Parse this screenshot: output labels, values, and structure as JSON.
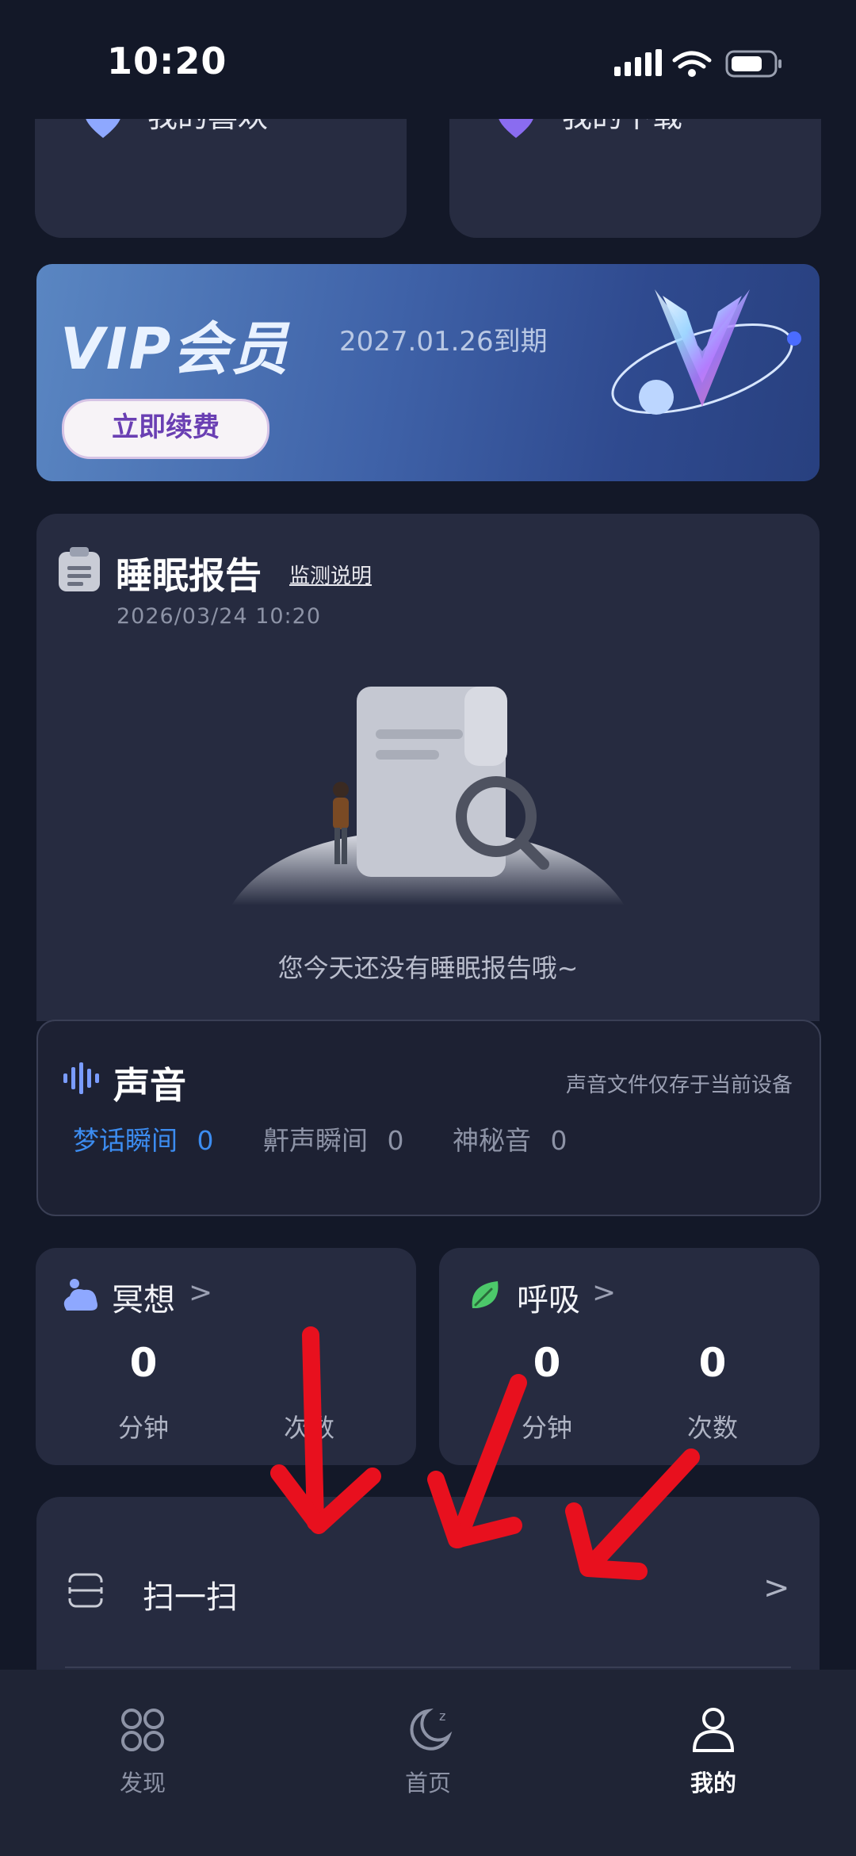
{
  "status_bar": {
    "time": "10:20",
    "battery_level": 0.7
  },
  "top_cards": {
    "left_label": "我的喜欢",
    "right_label": "我的下载",
    "chevron": ">"
  },
  "vip": {
    "title": "VIP会员",
    "expiry": "2027.01.26到期",
    "renew_button": "立即续费"
  },
  "sleep_report": {
    "title": "睡眠报告",
    "explain_link": "监测说明",
    "date": "2026/03/24 10:20",
    "empty_text": "您今天还没有睡眠报告哦~"
  },
  "sound": {
    "title": "声音",
    "note": "声音文件仅存于当前设备",
    "stats": [
      {
        "label": "梦话瞬间",
        "value": "0"
      },
      {
        "label": "鼾声瞬间",
        "value": "0"
      },
      {
        "label": "神秘音",
        "value": "0"
      }
    ]
  },
  "meditation": {
    "title": "冥想",
    "chevron": ">",
    "minutes": "0",
    "minutes_label": "分钟",
    "times_label": "次数"
  },
  "breathing": {
    "title": "呼吸",
    "chevron": ">",
    "minutes": "0",
    "minutes_label": "分钟",
    "times": "0",
    "times_label": "次数"
  },
  "scan": {
    "label": "扫一扫",
    "chevron": ">"
  },
  "bottom_nav": [
    {
      "label": "发现",
      "icon": "discover-icon"
    },
    {
      "label": "首页",
      "icon": "moon-icon"
    },
    {
      "label": "我的",
      "icon": "user-icon",
      "active": true
    }
  ],
  "colors": {
    "background": "#131828",
    "card": "#262b40",
    "accent_blue": "#3c8cf0",
    "annotation_red": "#e8101e"
  }
}
